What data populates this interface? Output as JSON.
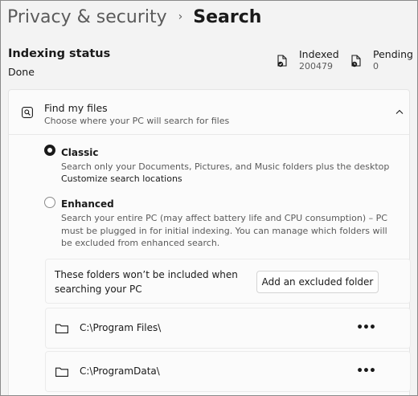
{
  "breadcrumb": {
    "parent": "Privacy & security",
    "separator": "›",
    "current": "Search"
  },
  "indexing": {
    "title": "Indexing status",
    "state": "Done",
    "stats": [
      {
        "label": "Indexed",
        "value": "200479",
        "icon": "document-check-icon"
      },
      {
        "label": "Pending",
        "value": "0",
        "icon": "document-clock-icon"
      }
    ]
  },
  "find_my_files": {
    "title": "Find my files",
    "subtitle": "Choose where your PC will search for files",
    "icon": "search-magnifier-icon",
    "expanded": true,
    "options": [
      {
        "label": "Classic",
        "selected": true,
        "description": "Search only your Documents, Pictures, and Music folders plus the desktop",
        "link": "Customize search locations"
      },
      {
        "label": "Enhanced",
        "selected": false,
        "description": "Search your entire PC (may affect battery life and CPU consumption) – PC must be plugged in for initial indexing. You can manage which folders will be excluded from enhanced search."
      }
    ]
  },
  "excluded": {
    "text": "These folders won’t be included when searching your PC",
    "button": "Add an excluded folder",
    "folders": [
      {
        "path": "C:\\Program Files\\",
        "menu": "•••"
      },
      {
        "path": "C:\\ProgramData\\",
        "menu": "•••"
      }
    ]
  },
  "colors": {
    "background": "#f3f3f3",
    "card": "#fbfbfb",
    "text": "#1a1a1a",
    "secondary_text": "#5b5b5b"
  }
}
